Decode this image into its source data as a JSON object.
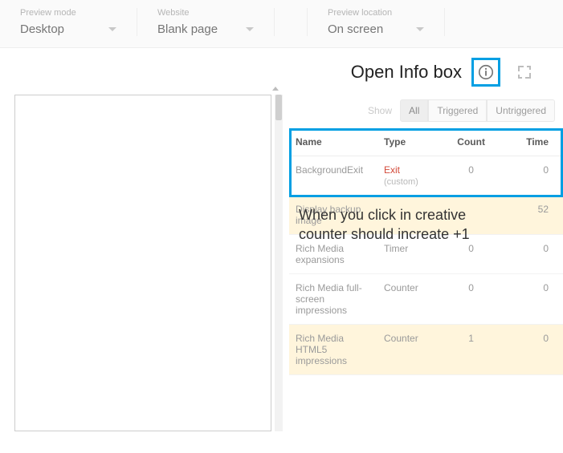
{
  "toolbar": {
    "preview_mode": {
      "label": "Preview mode",
      "value": "Desktop"
    },
    "website": {
      "label": "Website",
      "value": "Blank page"
    },
    "location": {
      "label": "Preview location",
      "value": "On screen"
    }
  },
  "infobar": {
    "title": "Open Info box"
  },
  "filters": {
    "show_label": "Show",
    "all": "All",
    "triggered": "Triggered",
    "untriggered": "Untriggered"
  },
  "table": {
    "headers": {
      "name": "Name",
      "type": "Type",
      "count": "Count",
      "time": "Time"
    },
    "rows": [
      {
        "name": "BackgroundExit",
        "type": "Exit",
        "sub": "(custom)",
        "count": "0",
        "time": "0",
        "exit": true,
        "hl": false
      },
      {
        "name": "Display backup image",
        "type": "",
        "sub": "",
        "count": "",
        "time": "52",
        "exit": false,
        "hl": true
      },
      {
        "name": "Rich Media expansions",
        "type": "Timer",
        "sub": "",
        "count": "0",
        "time": "0",
        "exit": false,
        "hl": false
      },
      {
        "name": "Rich Media full-screen impressions",
        "type": "Counter",
        "sub": "",
        "count": "0",
        "time": "0",
        "exit": false,
        "hl": false
      },
      {
        "name": "Rich Media HTML5 impressions",
        "type": "Counter",
        "sub": "",
        "count": "1",
        "time": "0",
        "exit": false,
        "hl": true
      }
    ]
  },
  "annotation": {
    "line1": "When you click in creative",
    "line2": "counter should increate +1"
  }
}
